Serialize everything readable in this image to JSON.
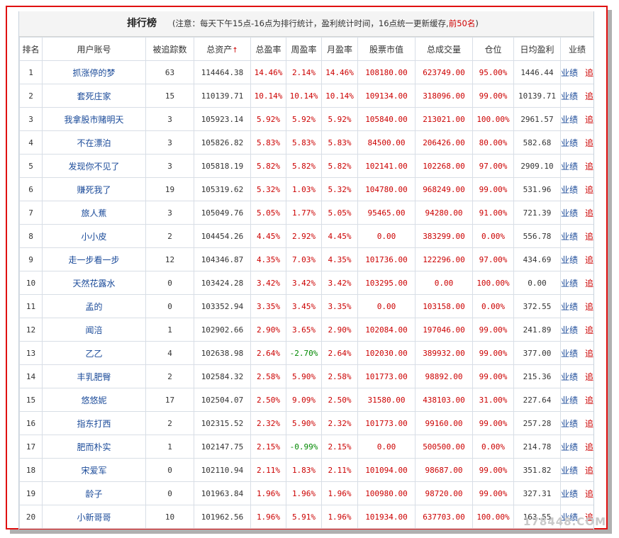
{
  "header": {
    "title": "排行榜",
    "note_prefix": "(注意：每天下午15点-16点为排行统计，盈利统计时间，16点统一更新缓存,",
    "note_highlight": "前50名",
    "note_suffix": ")"
  },
  "columns": [
    "排名",
    "用户账号",
    "被追踪数",
    "总资产",
    "总盈率",
    "周盈率",
    "月盈率",
    "股票市值",
    "总成交量",
    "仓位",
    "日均盈利",
    "业绩"
  ],
  "sort_arrow": "↑",
  "link_labels": {
    "perf": "业绩",
    "track": "追踪"
  },
  "rows": [
    {
      "rank": "1",
      "user": "抓涨停的梦",
      "followers": "63",
      "assets": "114464.38",
      "total": "14.46%",
      "week": "2.14%",
      "month": "14.46%",
      "stock_value": "108180.00",
      "volume": "623749.00",
      "position": "95.00%",
      "daily": "1446.44"
    },
    {
      "rank": "2",
      "user": "套死庄家",
      "followers": "15",
      "assets": "110139.71",
      "total": "10.14%",
      "week": "10.14%",
      "month": "10.14%",
      "stock_value": "109134.00",
      "volume": "318096.00",
      "position": "99.00%",
      "daily": "10139.71"
    },
    {
      "rank": "3",
      "user": "我拿股市赌明天",
      "followers": "3",
      "assets": "105923.14",
      "total": "5.92%",
      "week": "5.92%",
      "month": "5.92%",
      "stock_value": "105840.00",
      "volume": "213021.00",
      "position": "100.00%",
      "daily": "2961.57"
    },
    {
      "rank": "4",
      "user": "不在漂泊",
      "followers": "3",
      "assets": "105826.82",
      "total": "5.83%",
      "week": "5.83%",
      "month": "5.83%",
      "stock_value": "84500.00",
      "volume": "206426.00",
      "position": "80.00%",
      "daily": "582.68"
    },
    {
      "rank": "5",
      "user": "发现你不见了",
      "followers": "3",
      "assets": "105818.19",
      "total": "5.82%",
      "week": "5.82%",
      "month": "5.82%",
      "stock_value": "102141.00",
      "volume": "102268.00",
      "position": "97.00%",
      "daily": "2909.10"
    },
    {
      "rank": "6",
      "user": "赚死我了",
      "followers": "19",
      "assets": "105319.62",
      "total": "5.32%",
      "week": "1.03%",
      "month": "5.32%",
      "stock_value": "104780.00",
      "volume": "968249.00",
      "position": "99.00%",
      "daily": "531.96"
    },
    {
      "rank": "7",
      "user": "旅人蕉",
      "followers": "3",
      "assets": "105049.76",
      "total": "5.05%",
      "week": "1.77%",
      "month": "5.05%",
      "stock_value": "95465.00",
      "volume": "94280.00",
      "position": "91.00%",
      "daily": "721.39"
    },
    {
      "rank": "8",
      "user": "小小皮",
      "followers": "2",
      "assets": "104454.26",
      "total": "4.45%",
      "week": "2.92%",
      "month": "4.45%",
      "stock_value": "0.00",
      "volume": "383299.00",
      "position": "0.00%",
      "daily": "556.78"
    },
    {
      "rank": "9",
      "user": "走一步看一步",
      "followers": "12",
      "assets": "104346.87",
      "total": "4.35%",
      "week": "7.03%",
      "month": "4.35%",
      "stock_value": "101736.00",
      "volume": "122296.00",
      "position": "97.00%",
      "daily": "434.69"
    },
    {
      "rank": "10",
      "user": "天然花露水",
      "followers": "0",
      "assets": "103424.28",
      "total": "3.42%",
      "week": "3.42%",
      "month": "3.42%",
      "stock_value": "103295.00",
      "volume": "0.00",
      "position": "100.00%",
      "daily": "0.00"
    },
    {
      "rank": "11",
      "user": "孟的",
      "followers": "0",
      "assets": "103352.94",
      "total": "3.35%",
      "week": "3.45%",
      "month": "3.35%",
      "stock_value": "0.00",
      "volume": "103158.00",
      "position": "0.00%",
      "daily": "372.55"
    },
    {
      "rank": "12",
      "user": "闻涪",
      "followers": "1",
      "assets": "102902.66",
      "total": "2.90%",
      "week": "3.65%",
      "month": "2.90%",
      "stock_value": "102084.00",
      "volume": "197046.00",
      "position": "99.00%",
      "daily": "241.89"
    },
    {
      "rank": "13",
      "user": "乙乙",
      "followers": "4",
      "assets": "102638.98",
      "total": "2.64%",
      "week": "-2.70%",
      "month": "2.64%",
      "stock_value": "102030.00",
      "volume": "389932.00",
      "position": "99.00%",
      "daily": "377.00"
    },
    {
      "rank": "14",
      "user": "丰乳肥臀",
      "followers": "2",
      "assets": "102584.32",
      "total": "2.58%",
      "week": "5.90%",
      "month": "2.58%",
      "stock_value": "101773.00",
      "volume": "98892.00",
      "position": "99.00%",
      "daily": "215.36"
    },
    {
      "rank": "15",
      "user": "悠悠妮",
      "followers": "17",
      "assets": "102504.07",
      "total": "2.50%",
      "week": "9.09%",
      "month": "2.50%",
      "stock_value": "31580.00",
      "volume": "438103.00",
      "position": "31.00%",
      "daily": "227.64"
    },
    {
      "rank": "16",
      "user": "指东打西",
      "followers": "2",
      "assets": "102315.52",
      "total": "2.32%",
      "week": "5.90%",
      "month": "2.32%",
      "stock_value": "101773.00",
      "volume": "99160.00",
      "position": "99.00%",
      "daily": "257.28"
    },
    {
      "rank": "17",
      "user": "肥而朴实",
      "followers": "1",
      "assets": "102147.75",
      "total": "2.15%",
      "week": "-0.99%",
      "month": "2.15%",
      "stock_value": "0.00",
      "volume": "500500.00",
      "position": "0.00%",
      "daily": "214.78"
    },
    {
      "rank": "18",
      "user": "宋爱军",
      "followers": "0",
      "assets": "102110.94",
      "total": "2.11%",
      "week": "1.83%",
      "month": "2.11%",
      "stock_value": "101094.00",
      "volume": "98687.00",
      "position": "99.00%",
      "daily": "351.82"
    },
    {
      "rank": "19",
      "user": "龄子",
      "followers": "0",
      "assets": "101963.84",
      "total": "1.96%",
      "week": "1.96%",
      "month": "1.96%",
      "stock_value": "100980.00",
      "volume": "98720.00",
      "position": "99.00%",
      "daily": "327.31"
    },
    {
      "rank": "20",
      "user": "小新哥哥",
      "followers": "10",
      "assets": "101962.56",
      "total": "1.96%",
      "week": "5.91%",
      "month": "1.96%",
      "stock_value": "101934.00",
      "volume": "637703.00",
      "position": "100.00%",
      "daily": "163.55"
    }
  ],
  "watermark": "178448.COM",
  "colors": {
    "positive": "#cc0000",
    "negative": "#008800",
    "link": "#1a4a99",
    "frame": "#e01010"
  }
}
